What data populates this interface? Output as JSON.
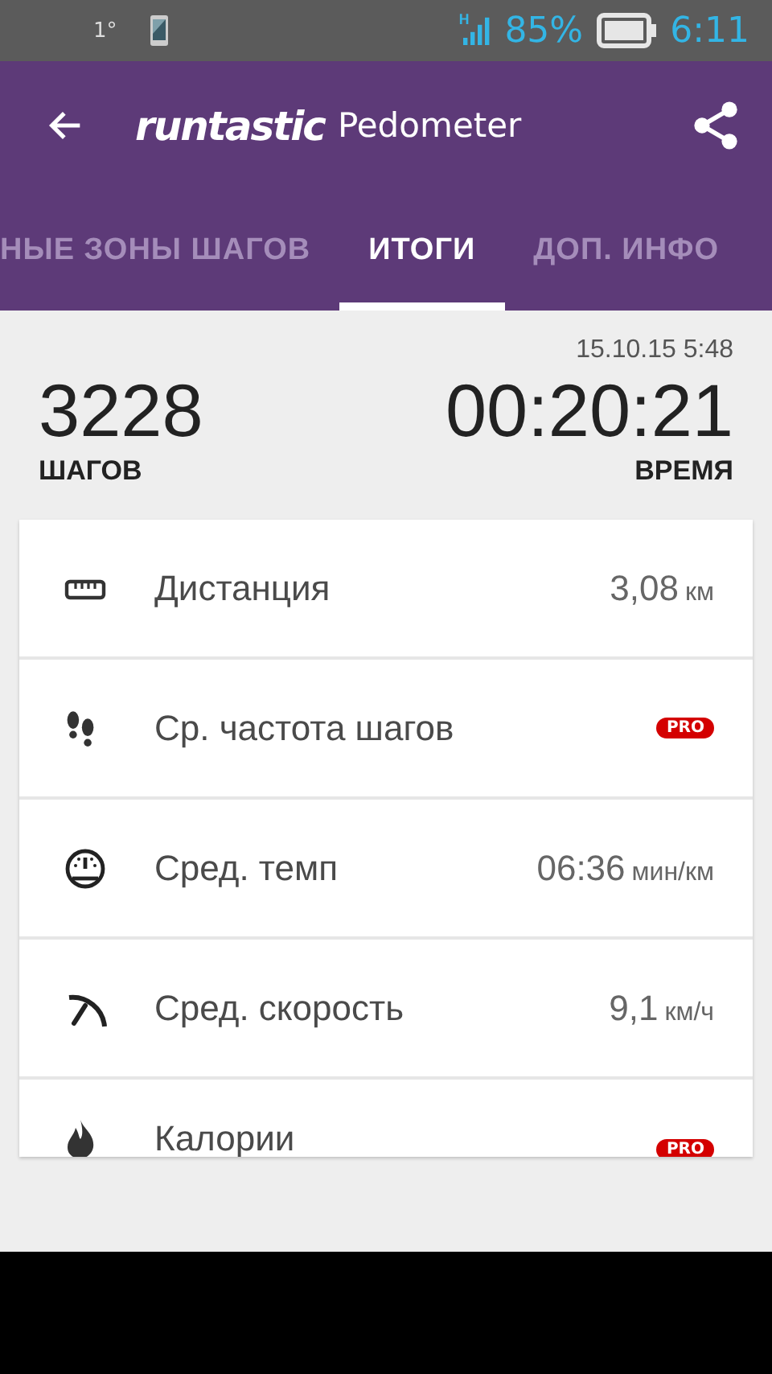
{
  "status_bar": {
    "temperature": "1°",
    "signal_type": "H",
    "battery": "85%",
    "time": "6:11"
  },
  "app_bar": {
    "logo": "runtastic",
    "title": "Pedometer"
  },
  "tabs": [
    {
      "label": "НЫЕ ЗОНЫ ШАГОВ",
      "selected": false
    },
    {
      "label": "ИТОГИ",
      "selected": true
    },
    {
      "label": "ДОП. ИНФО",
      "selected": false
    }
  ],
  "date": "15.10.15 5:48",
  "summary": [
    {
      "value": "3228",
      "label": "ШАГОВ"
    },
    {
      "value": "00:20:21",
      "label": "ВРЕМЯ"
    }
  ],
  "metrics": [
    {
      "kind": "value",
      "label": "Дистанция",
      "value": "3,08",
      "unit": "км"
    },
    {
      "kind": "pro",
      "label": "Ср. частота шагов",
      "badge": "PRO"
    },
    {
      "kind": "value",
      "label": "Сред. темп",
      "value": "06:36",
      "unit": "мин/км"
    },
    {
      "kind": "value",
      "label": "Сред. скорость",
      "value": "9,1",
      "unit": "км/ч"
    },
    {
      "kind": "pro",
      "label": "Калории",
      "badge": "PRO"
    }
  ]
}
